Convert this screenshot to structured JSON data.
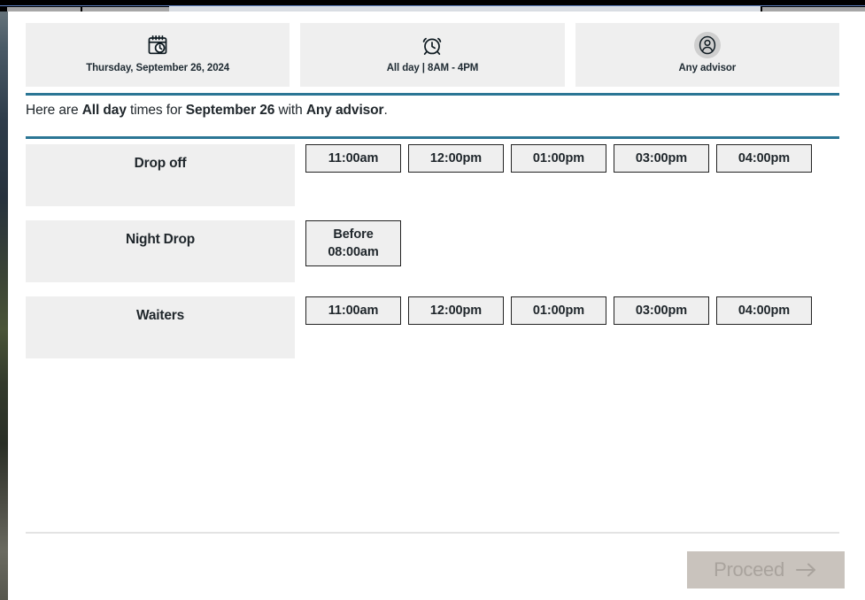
{
  "window": {
    "background_color": "#ffffff",
    "accent_color": "#2b7695",
    "panel_color": "#efefef"
  },
  "summary": {
    "cards": [
      {
        "id": "date",
        "icon": "calendar-clock-icon",
        "label": "Thursday, September 26, 2024"
      },
      {
        "id": "time",
        "icon": "alarm-clock-icon",
        "label": "All day | 8AM - 4PM"
      },
      {
        "id": "advisor",
        "icon": "person-avatar-icon",
        "label": "Any advisor"
      }
    ],
    "sentence": {
      "prefix": "Here are ",
      "bold1": "All day",
      "middle1": " times for ",
      "bold2": "September 26",
      "middle2": " with ",
      "bold3": "Any advisor",
      "suffix": "."
    }
  },
  "services": [
    {
      "name": "Drop off",
      "slots": [
        {
          "label": "11:00am"
        },
        {
          "label": "12:00pm"
        },
        {
          "label": "01:00pm"
        },
        {
          "label": "03:00pm"
        },
        {
          "label": "04:00pm"
        }
      ]
    },
    {
      "name": "Night Drop",
      "slots": [
        {
          "label": "Before\n08:00am",
          "two_line": true
        }
      ]
    },
    {
      "name": "Waiters",
      "slots": [
        {
          "label": "11:00am"
        },
        {
          "label": "12:00pm"
        },
        {
          "label": "01:00pm"
        },
        {
          "label": "03:00pm"
        },
        {
          "label": "04:00pm"
        }
      ]
    }
  ],
  "footer": {
    "proceed_label": "Proceed",
    "proceed_arrow_icon": "arrow-right-icon",
    "proceed_enabled": false
  }
}
